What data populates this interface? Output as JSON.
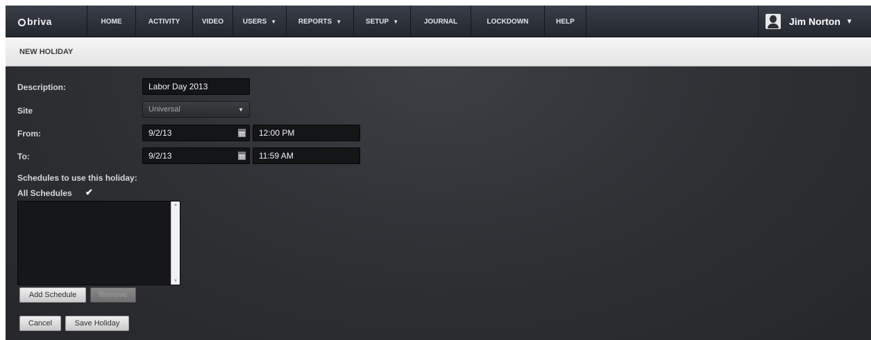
{
  "nav": {
    "logo": "briva",
    "items": [
      {
        "label": "HOME",
        "caret": ""
      },
      {
        "label": "ACTIVITY",
        "caret": ""
      },
      {
        "label": "VIDEO",
        "caret": ""
      },
      {
        "label": "USERS",
        "caret": "▼"
      },
      {
        "label": "REPORTS",
        "caret": "▼"
      },
      {
        "label": "SETUP",
        "caret": "▼"
      },
      {
        "label": "JOURNAL",
        "caret": ""
      },
      {
        "label": "LOCKDOWN",
        "caret": ""
      },
      {
        "label": "HELP",
        "caret": ""
      }
    ],
    "user": {
      "name": "Jim Norton",
      "caret": "▼"
    }
  },
  "page": {
    "title": "NEW HOLIDAY"
  },
  "form": {
    "description": {
      "label": "Description:",
      "value": "Labor Day 2013"
    },
    "site": {
      "label": "Site",
      "value": "Universal",
      "caret": "▼"
    },
    "from": {
      "label": "From:",
      "date": "9/2/13",
      "time": "12:00 PM"
    },
    "to": {
      "label": "To:",
      "date": "9/2/13",
      "time": "11:59 AM"
    },
    "schedules_label": "Schedules to use this holiday:",
    "all_schedules": {
      "label": "All Schedules",
      "checked": true,
      "mark": "✔"
    },
    "schedule_list": []
  },
  "buttons": {
    "add_schedule": "Add Schedule",
    "remove": "Remove",
    "cancel": "Cancel",
    "save_holiday": "Save Holiday"
  }
}
